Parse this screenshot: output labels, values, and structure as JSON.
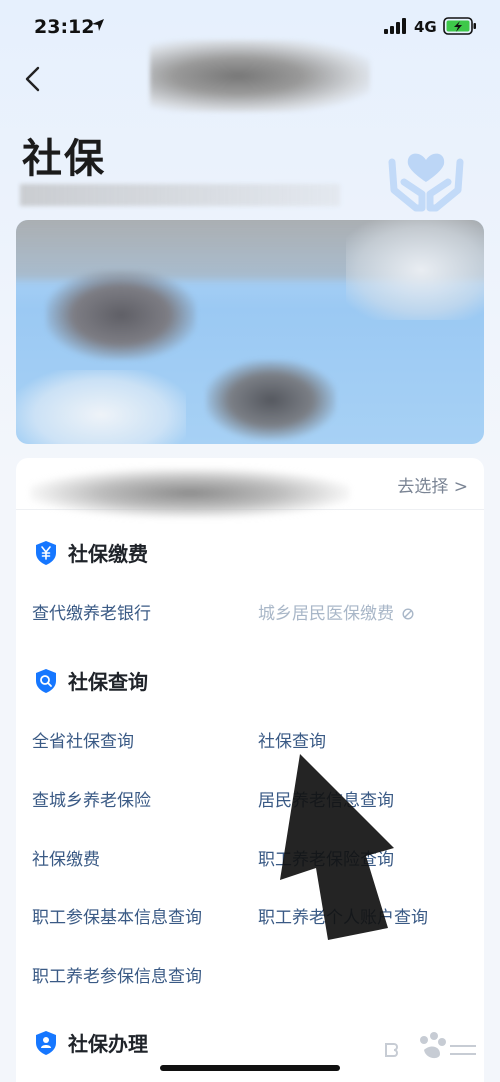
{
  "status_bar": {
    "time": "23:12",
    "network": "4G"
  },
  "page": {
    "title": "社保"
  },
  "card": {
    "choose_link": "去选择 >"
  },
  "sections": {
    "payment": {
      "title": "社保缴费",
      "icon": "yuan-shield-icon",
      "items": [
        "查代缴养老银行",
        "城乡居民医保缴费"
      ]
    },
    "query": {
      "title": "社保查询",
      "icon": "search-shield-icon",
      "items": [
        "全省社保查询",
        "社保查询",
        "查城乡养老保险",
        "居民养老信息查询",
        "社保缴费",
        "职工养老保险查询",
        "职工参保基本信息查询",
        "职工养老个人账户查询",
        "职工养老参保信息查询"
      ]
    },
    "handle": {
      "title": "社保办理",
      "icon": "person-shield-icon"
    }
  },
  "colors": {
    "accent_blue": "#1677ff",
    "link_text": "#3a5a85",
    "disabled_text": "#a9b7c8"
  }
}
